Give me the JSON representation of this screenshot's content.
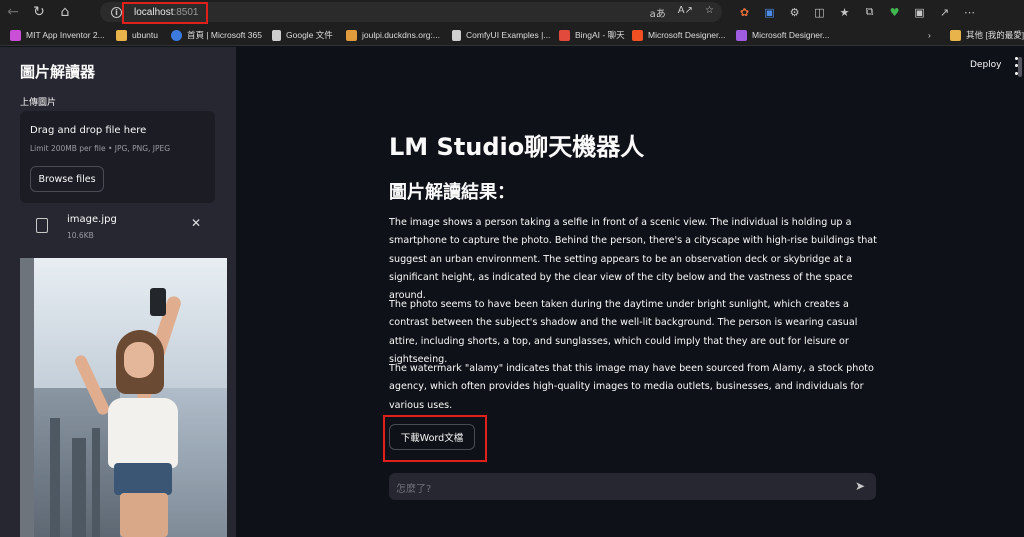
{
  "browser": {
    "url_host": "localhost",
    "url_port": ":8501",
    "bookmarks": [
      {
        "label": "MIT App Inventor 2...",
        "color": "#c94fd6"
      },
      {
        "label": "ubuntu",
        "color": "#e8b34a"
      },
      {
        "label": "首頁 | Microsoft 365",
        "color": "#3b7be0"
      },
      {
        "label": "Google 文件",
        "color": "#cfcfcf"
      },
      {
        "label": "joulpi.duckdns.org:...",
        "color": "#e09b3d"
      },
      {
        "label": "ComfyUI Examples |...",
        "color": "#cfcfcf"
      },
      {
        "label": "BingAI - 聊天",
        "color": "#e24a3b"
      },
      {
        "label": "Microsoft Designer...",
        "color": "#f25022"
      },
      {
        "label": "Microsoft Designer...",
        "color": "#a05ce0"
      },
      {
        "label": "其他 [我的最愛]",
        "color": "#e8b34a"
      }
    ]
  },
  "sidebar": {
    "title": "圖片解讀器",
    "upload_label": "上傳圖片",
    "dropzone_title": "Drag and drop file here",
    "dropzone_limit": "Limit 200MB per file • JPG, PNG, JPEG",
    "browse_label": "Browse files",
    "file_name": "image.jpg",
    "file_size": "10.6KB"
  },
  "main": {
    "deploy_label": "Deploy",
    "title": "LM Studio聊天機器人",
    "subtitle": "圖片解讀結果：",
    "paragraphs": [
      "The image shows a person taking a selfie in front of a scenic view. The individual is holding up a smartphone to capture the photo. Behind the person, there's a cityscape with high-rise buildings that suggest an urban environment. The setting appears to be an observation deck or skybridge at a significant height, as indicated by the clear view of the city below and the vastness of the space around.",
      "The photo seems to have been taken during the daytime under bright sunlight, which creates a contrast between the subject's shadow and the well-lit background. The person is wearing casual attire, including shorts, a top, and sunglasses, which could imply that they are out for leisure or sightseeing.",
      "The watermark \"alamy\" indicates that this image may have been sourced from Alamy, a stock photo agency, which often provides high-quality images to media outlets, businesses, and individuals for various uses."
    ],
    "download_label": "下載Word文檔",
    "chat_placeholder": "怎麼了?"
  }
}
